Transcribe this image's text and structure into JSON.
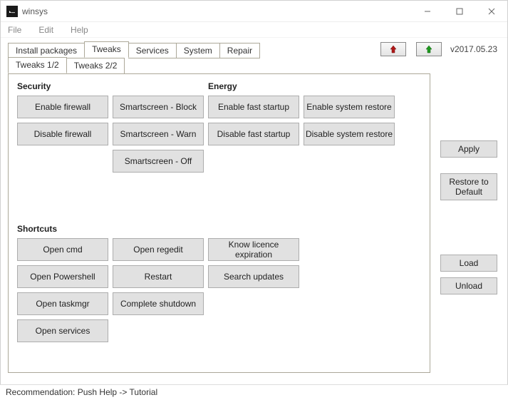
{
  "window": {
    "title": "winsys",
    "version": "v2017.05.23"
  },
  "menu": {
    "file": "File",
    "edit": "Edit",
    "help": "Help"
  },
  "maintabs": {
    "install": "Install packages",
    "tweaks": "Tweaks",
    "services": "Services",
    "system": "System",
    "repair": "Repair"
  },
  "subtabs": {
    "t1": "Tweaks 1/2",
    "t2": "Tweaks 2/2"
  },
  "sections": {
    "security": "Security",
    "energy": "Energy",
    "shortcuts": "Shortcuts"
  },
  "security": {
    "enable_fw": "Enable firewall",
    "disable_fw": "Disable firewall",
    "ss_block": "Smartscreen - Block",
    "ss_warn": "Smartscreen - Warn",
    "ss_off": "Smartscreen - Off"
  },
  "energy": {
    "enable_fs": "Enable fast startup",
    "disable_fs": "Disable fast startup",
    "enable_sr": "Enable system restore",
    "disable_sr": "Disable system restore"
  },
  "shortcuts": {
    "cmd": "Open cmd",
    "powershell": "Open Powershell",
    "taskmgr": "Open taskmgr",
    "services": "Open services",
    "regedit": "Open regedit",
    "restart": "Restart",
    "shutdown": "Complete shutdown",
    "licence": "Know licence expiration",
    "updates": "Search updates"
  },
  "side": {
    "apply": "Apply",
    "restore": "Restore\nto Default",
    "load": "Load",
    "unload": "Unload"
  },
  "status": "Recommendation: Push Help -> Tutorial"
}
